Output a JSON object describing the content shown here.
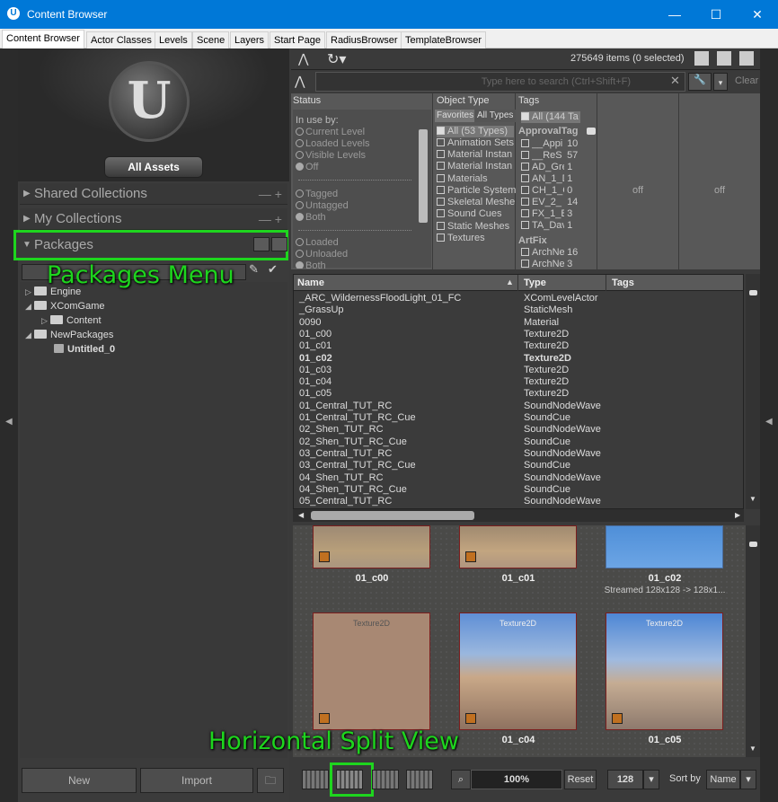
{
  "window": {
    "title": "Content Browser",
    "minimize": "—",
    "maximize": "☐",
    "close": "✕"
  },
  "tabs": [
    "Content Browser",
    "Actor Classes",
    "Levels",
    "Scene",
    "Layers",
    "Start Page",
    "RadiusBrowser",
    "TemplateBrowser"
  ],
  "left": {
    "all_assets": "All Assets",
    "shared_collections": "Shared Collections",
    "my_collections": "My Collections",
    "packages": "Packages",
    "tree": [
      {
        "label": "Engine",
        "bold": false
      },
      {
        "label": "XComGame",
        "bold": false
      },
      {
        "label": "Content",
        "bold": false
      },
      {
        "label": "NewPackages",
        "bold": false
      },
      {
        "label": "Untitled_0",
        "bold": true
      }
    ],
    "new_button": "New",
    "import_button": "Import"
  },
  "annotations": {
    "packages_menu": "Packages Menu",
    "horizontal_split": "Horizontal Split View"
  },
  "toolbar": {
    "item_count": "275649 items (0 selected)",
    "search_placeholder": "Type here to search  (Ctrl+Shift+F)",
    "clear": "Clear"
  },
  "filters": {
    "status": {
      "header": "Status",
      "in_use_by": "In use by:",
      "options": [
        "Current Level",
        "Loaded Levels",
        "Visible Levels",
        "Off",
        "Tagged",
        "Untagged",
        "Both",
        "Loaded",
        "Unloaded",
        "Both"
      ]
    },
    "object_type": {
      "header": "Object Type",
      "favorites": "Favorites",
      "all_types": "All Types",
      "items": [
        "All (53 Types)",
        "Animation Sets",
        "Material Instan",
        "Material Instan",
        "Materials",
        "Particle System",
        "Skeletal Meshe",
        "Sound Cues",
        "Static Meshes",
        "Textures"
      ]
    },
    "tags": {
      "header": "Tags",
      "all": "All (144 Ta",
      "group1": "ApprovalTag",
      "items": [
        {
          "n": "__Appi",
          "c": "10"
        },
        {
          "n": "__ReS",
          "c": "57"
        },
        {
          "n": "AD_Gre",
          "c": "1"
        },
        {
          "n": "AN_1_D",
          "c": "1"
        },
        {
          "n": "CH_1_C",
          "c": "0"
        },
        {
          "n": "EV_2_",
          "c": "14"
        },
        {
          "n": "FX_1_B",
          "c": "3"
        },
        {
          "n": "TA_Dav",
          "c": "1"
        }
      ],
      "group2": "ArtFix",
      "items2": [
        {
          "n": "ArchNe",
          "c": "16"
        },
        {
          "n": "ArchNe",
          "c": "3"
        }
      ]
    },
    "extra": [
      "off",
      "off"
    ]
  },
  "list": {
    "headers": [
      "Name",
      "Type",
      "Tags"
    ],
    "rows": [
      [
        "_ARC_WildernessFloodLight_01_FC",
        "XComLevelActor"
      ],
      [
        "_GrassUp",
        "StaticMesh"
      ],
      [
        "0090",
        "Material"
      ],
      [
        "01_c00",
        "Texture2D"
      ],
      [
        "01_c01",
        "Texture2D"
      ],
      [
        "01_c02",
        "Texture2D"
      ],
      [
        "01_c03",
        "Texture2D"
      ],
      [
        "01_c04",
        "Texture2D"
      ],
      [
        "01_c05",
        "Texture2D"
      ],
      [
        "01_Central_TUT_RC",
        "SoundNodeWave"
      ],
      [
        "01_Central_TUT_RC_Cue",
        "SoundCue"
      ],
      [
        "02_Shen_TUT_RC",
        "SoundNodeWave"
      ],
      [
        "02_Shen_TUT_RC_Cue",
        "SoundCue"
      ],
      [
        "03_Central_TUT_RC",
        "SoundNodeWave"
      ],
      [
        "03_Central_TUT_RC_Cue",
        "SoundCue"
      ],
      [
        "04_Shen_TUT_RC",
        "SoundNodeWave"
      ],
      [
        "04_Shen_TUT_RC_Cue",
        "SoundCue"
      ],
      [
        "05_Central_TUT_RC",
        "SoundNodeWave"
      ]
    ],
    "bold_row": 5
  },
  "thumbs": {
    "top": [
      {
        "label": "01_c00"
      },
      {
        "label": "01_c01"
      },
      {
        "label": "01_c02",
        "sub": "Streamed 128x128 -> 128x1..."
      }
    ],
    "bottom": [
      {
        "type": "Texture2D",
        "label": ""
      },
      {
        "type": "Texture2D",
        "label": "01_c04"
      },
      {
        "type": "Texture2D",
        "label": "01_c05"
      }
    ]
  },
  "bottom": {
    "zoom": "100%",
    "reset": "Reset",
    "size": "128",
    "sort_by": "Sort by",
    "sort_value": "Name"
  }
}
